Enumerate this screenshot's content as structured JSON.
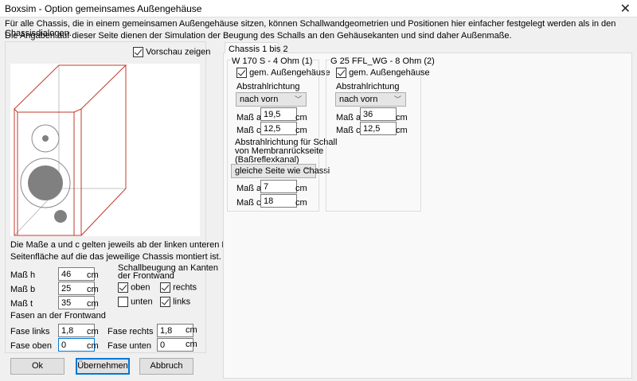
{
  "window": {
    "title": "Boxsim - Option gemeinsames Außengehäuse",
    "close": "✕"
  },
  "info": {
    "line1": "Für alle Chassis, die in einem gemeinsamen Außengehäuse sitzen, können Schallwandgeometrien und Positionen hier einfacher festgelegt werden als in den Chassisdialogen.",
    "line2": "Die Angaben auf dieser Seite dienen der Simulation der  Beugung des Schalls an den Gehäusekanten und sind daher Außenmaße."
  },
  "preview": {
    "label": "Vorschau zeigen",
    "checked": true,
    "colors": {
      "edge": "#c0392b",
      "hidden": "#b0b0b0",
      "driver": "#808080"
    }
  },
  "note": {
    "line1": "Die Maße a und c gelten jeweils ab der linken unteren Ecke der",
    "line2": "Seitenfläche auf die das jeweilige Chassis montiert ist."
  },
  "dims": [
    {
      "label": "Maß h",
      "value": "46",
      "unit": "cm"
    },
    {
      "label": "Maß b",
      "value": "25",
      "unit": "cm"
    },
    {
      "label": "Maß t",
      "value": "35",
      "unit": "cm"
    }
  ],
  "diffraction": {
    "title1": "Schallbeugung an Kanten",
    "title2": "der Frontwand",
    "oben": {
      "label": "oben",
      "checked": true
    },
    "rechts": {
      "label": "rechts",
      "checked": true
    },
    "unten": {
      "label": "unten",
      "checked": false
    },
    "links": {
      "label": "links",
      "checked": true
    }
  },
  "bevels": {
    "title": "Fasen an der Frontwand",
    "links": {
      "label": "Fase links",
      "value": "1,8",
      "unit": "cm"
    },
    "rechts": {
      "label": "Fase rechts",
      "value": "1,8",
      "unit": "cm"
    },
    "oben": {
      "label": "Fase oben",
      "value": "0",
      "unit": "cm"
    },
    "unten": {
      "label": "Fase unten",
      "value": "0",
      "unit": "cm"
    }
  },
  "buttons": {
    "ok": "Ok",
    "apply": "Übernehmen",
    "cancel": "Abbruch"
  },
  "tab": {
    "label": "Chassis 1 bis 2"
  },
  "chassis": [
    {
      "title": "W 170 S - 4 Ohm (1)",
      "shared_label": "gem. Außengehäuse",
      "shared": true,
      "dir_label": "Abstrahlrichtung",
      "dir": "nach vorn",
      "a_label": "Maß a",
      "a": "19,5",
      "c_label": "Maß c",
      "c": "12,5",
      "unit": "cm",
      "rear_label1": "Abstrahlrichtung für Schall",
      "rear_label2": "von Membranrückseite",
      "rear_label3": "(Baßreflexkanal)",
      "rear_dir": "gleiche Seite wie Chassi",
      "rear_a": "7",
      "rear_c": "18"
    },
    {
      "title": "G 25 FFL_WG - 8 Ohm (2)",
      "shared_label": "gem. Außengehäuse",
      "shared": true,
      "dir_label": "Abstrahlrichtung",
      "dir": "nach vorn",
      "a_label": "Maß a",
      "a": "36",
      "c_label": "Maß c",
      "c": "12,5",
      "unit": "cm"
    }
  ]
}
